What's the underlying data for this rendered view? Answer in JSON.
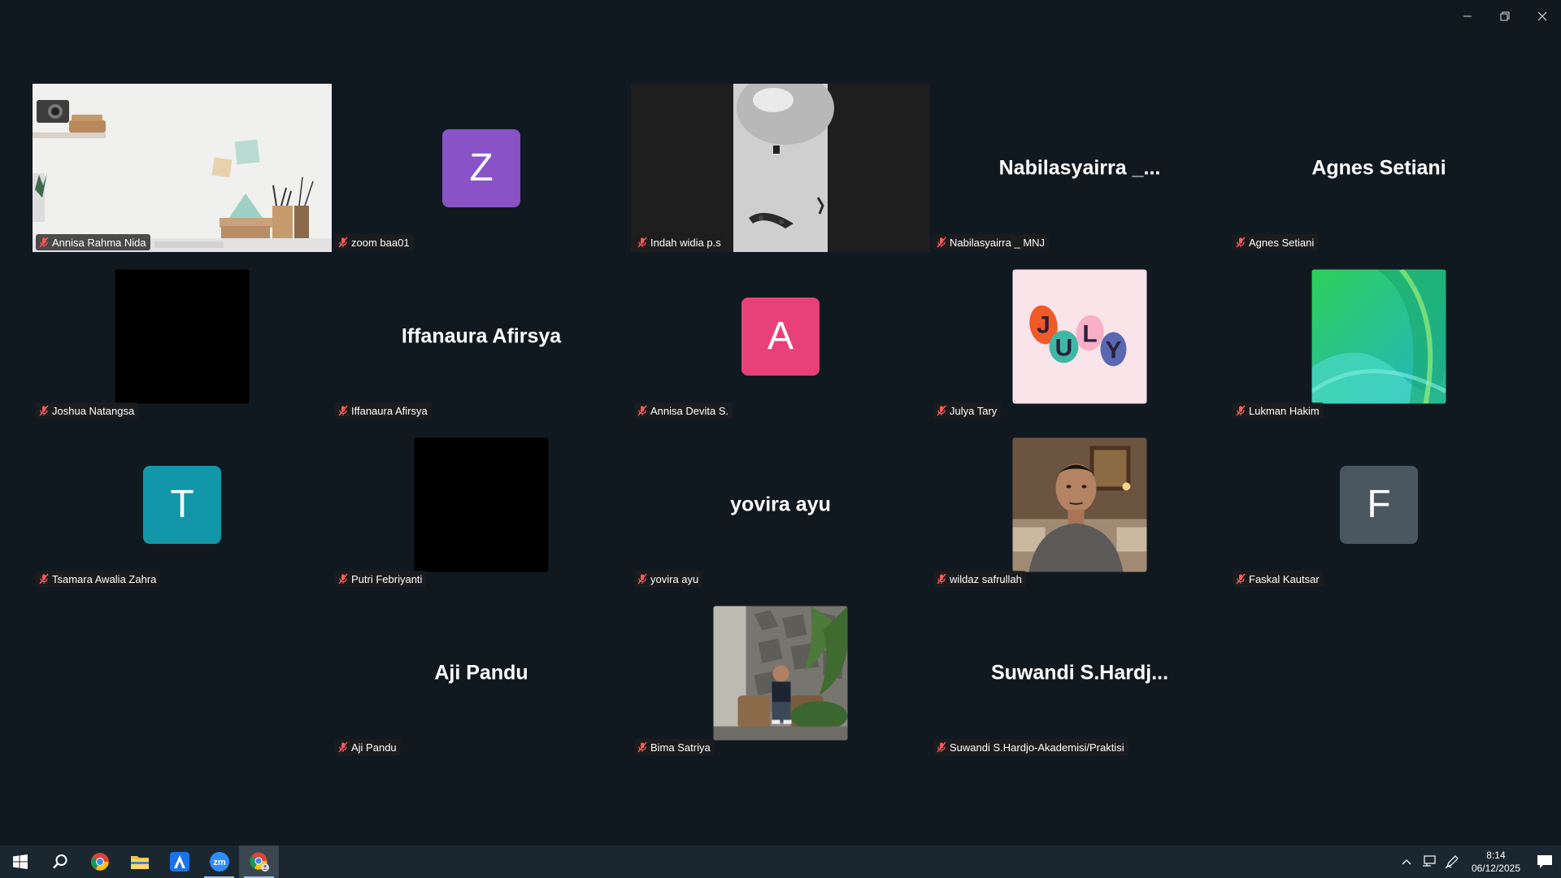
{
  "window": {
    "controls": [
      "minimize",
      "restore",
      "close"
    ]
  },
  "participants": [
    {
      "name": "Annisa Rahma Nida",
      "type": "video",
      "video": "desk-shelf-scene",
      "active": true
    },
    {
      "name": "zoom baa01",
      "type": "avatar",
      "initial": "Z",
      "color": "#8a52c7"
    },
    {
      "name": "Indah widia p.s",
      "type": "video",
      "video": "ceiling-light-scene"
    },
    {
      "name": "Nabilasyairra _ MNJ",
      "type": "name",
      "display": "Nabilasyairra _..."
    },
    {
      "name": "Agnes Setiani",
      "type": "name",
      "display": "Agnes Setiani"
    },
    {
      "name": "Joshua Natangsa",
      "type": "picture",
      "picture": "black-picture"
    },
    {
      "name": "Iffanaura Afirsya",
      "type": "name",
      "display": "Iffanaura Afirsya"
    },
    {
      "name": "Annisa Devita S.",
      "type": "avatar",
      "initial": "A",
      "color": "#e8417a"
    },
    {
      "name": "Julya Tary",
      "type": "picture",
      "picture": "july-lettering-picture",
      "picture_text": [
        "J",
        "U",
        "L",
        "Y"
      ]
    },
    {
      "name": "Lukman Hakim",
      "type": "picture",
      "picture": "green-wave-picture"
    },
    {
      "name": "Tsamara Awalia Zahra",
      "type": "avatar",
      "initial": "T",
      "color": "#1297a8"
    },
    {
      "name": "Putri Febriyanti",
      "type": "picture",
      "picture": "black-picture"
    },
    {
      "name": "yovira ayu",
      "type": "name",
      "display": "yovira ayu"
    },
    {
      "name": "wildaz safrullah",
      "type": "picture",
      "picture": "man-portrait-picture"
    },
    {
      "name": "Faskal Kautsar",
      "type": "avatar",
      "initial": "F",
      "color": "#4a5660"
    },
    {
      "name": "",
      "type": "empty"
    },
    {
      "name": "Aji Pandu",
      "type": "name",
      "display": "Aji Pandu"
    },
    {
      "name": "Bima Satriya",
      "type": "picture",
      "picture": "man-stone-wall-picture"
    },
    {
      "name": "Suwandi S.Hardjo-Akademisi/Praktisi",
      "type": "name",
      "display": "Suwandi  S.Hardj..."
    }
  ],
  "taskbar": {
    "apps": [
      "windows-start-icon",
      "search-icon",
      "chrome-icon",
      "file-explorer-icon",
      "arc-app-icon",
      "zoom-icon",
      "chrome-profile-icon"
    ],
    "time": "8:14",
    "date": "06/12/2025",
    "notification_count": "1"
  },
  "colors": {
    "background": "#111920",
    "active_border": "#2bd888",
    "taskbar": "#1b2730"
  }
}
